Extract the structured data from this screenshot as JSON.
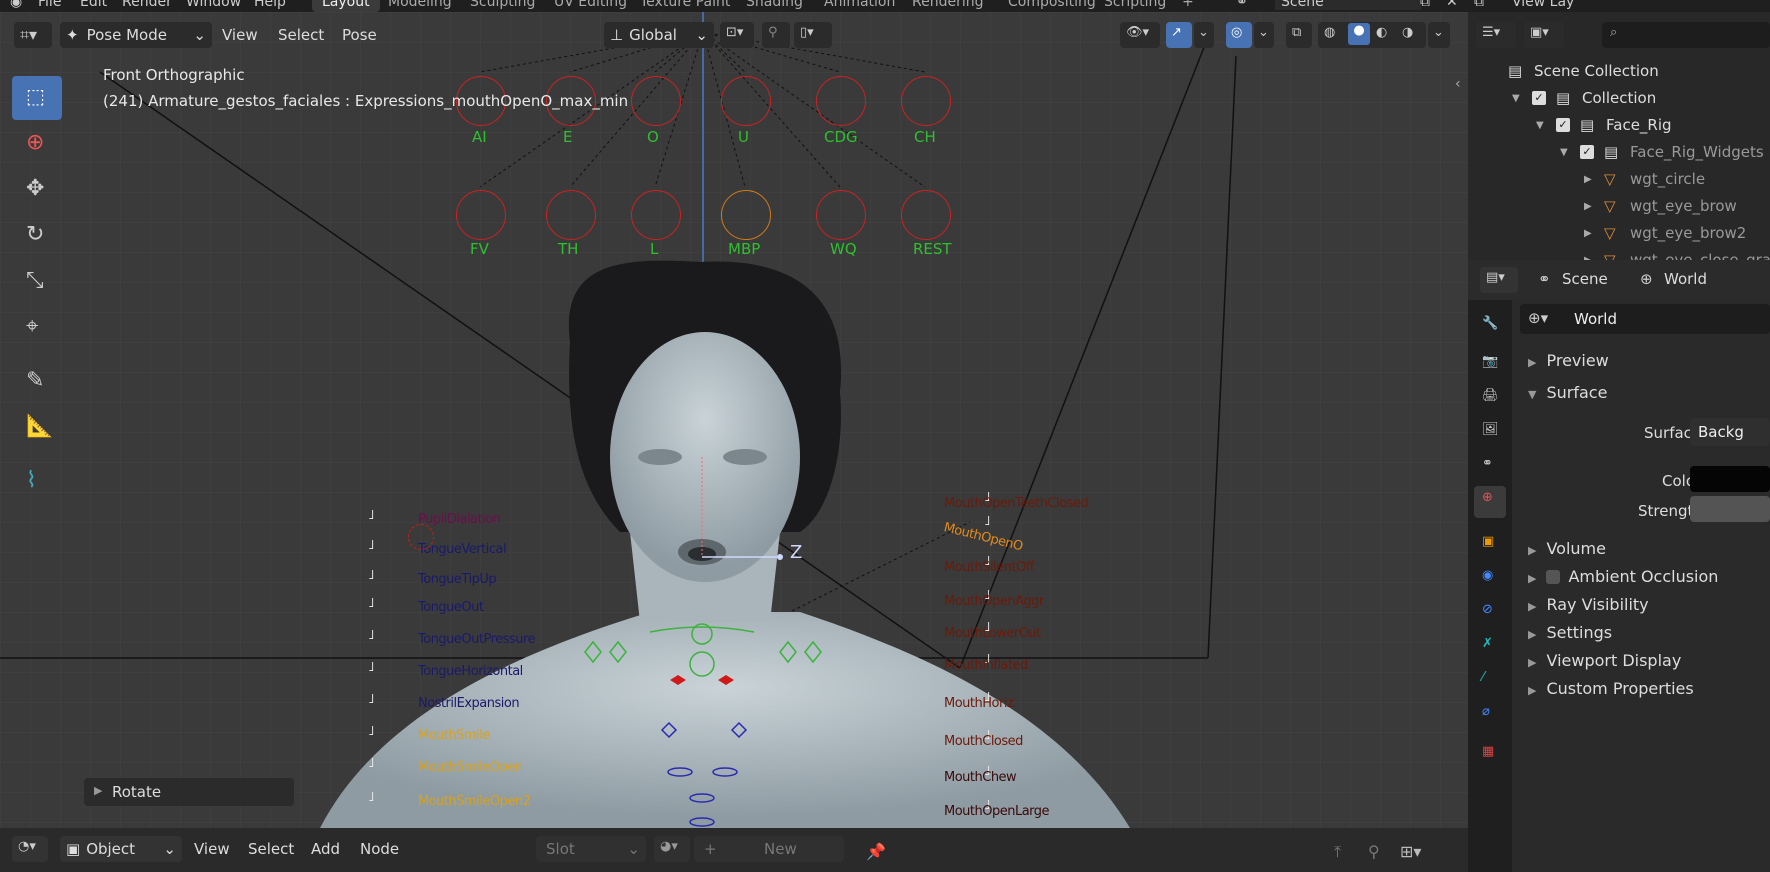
{
  "topbar": {
    "menus": [
      "File",
      "Edit",
      "Render",
      "Window",
      "Help"
    ],
    "workspaces": [
      "Layout",
      "Modeling",
      "Sculpting",
      "UV Editing",
      "Texture Paint",
      "Shading",
      "Animation",
      "Rendering",
      "Compositing",
      "Scripting"
    ],
    "active_workspace": "Layout",
    "add_tab": "+",
    "scene": "Scene",
    "view_layer": "View Lay"
  },
  "viewport_header": {
    "mode": "Pose Mode",
    "menus": [
      "View",
      "Select",
      "Pose"
    ],
    "orientation": "Global"
  },
  "viewport_overlay": {
    "view_name": "Front Orthographic",
    "object_info": "(241) Armature_gestos_faciales : Expressions_mouthOpenO_max_min",
    "gizmo_axis": "Z",
    "last_op": "Rotate"
  },
  "phonemes_row1": [
    "AI",
    "E",
    "O",
    "U",
    "CDG",
    "CH"
  ],
  "phonemes_row2": [
    "FV",
    "TH",
    "L",
    "MBP",
    "WQ",
    "REST"
  ],
  "left_bones": [
    {
      "label": "PupilDialation",
      "color": "#6a0f4a"
    },
    {
      "label": "TongueVertical",
      "color": "#1a1a6a"
    },
    {
      "label": "TongueTipUp",
      "color": "#1a1a6a"
    },
    {
      "label": "TongueOut",
      "color": "#1a1a6a"
    },
    {
      "label": "TongueOutPressure",
      "color": "#1a1a6a"
    },
    {
      "label": "TongueHorizontal",
      "color": "#1a1a6a"
    },
    {
      "label": "NostrilExpansion",
      "color": "#1a1a6a"
    },
    {
      "label": "MouthSmile",
      "color": "#d9a21a"
    },
    {
      "label": "MouthSmileOpen",
      "color": "#d9a21a"
    },
    {
      "label": "MouthSmileOpen2",
      "color": "#d9a21a"
    }
  ],
  "right_bones": [
    {
      "label": "MouthOpenTeethClosed",
      "color": "#6a1a0a"
    },
    {
      "label": "MouthOpenO",
      "color": "#e08a1a"
    },
    {
      "label": "MouthSilentOff",
      "color": "#6a1a0a"
    },
    {
      "label": "MouthOpenAggr",
      "color": "#6a1a0a"
    },
    {
      "label": "MouthLowerOut",
      "color": "#6a1a0a"
    },
    {
      "label": "MouthInflated",
      "color": "#6a1a0a"
    },
    {
      "label": "MouthHoriz",
      "color": "#6a1a0a"
    },
    {
      "label": "MouthClosed",
      "color": "#6a1a0a"
    },
    {
      "label": "MouthChew",
      "color": "#3a0a0a"
    },
    {
      "label": "MouthOpenLarge",
      "color": "#3a0a0a"
    }
  ],
  "bottom_header": {
    "mode": "Object",
    "menus": [
      "View",
      "Select",
      "Add",
      "Node"
    ],
    "slot": "Slot",
    "new_label": "New"
  },
  "outliner": {
    "search_placeholder": "",
    "items": [
      {
        "label": "Scene Collection",
        "indent": 0
      },
      {
        "label": "Collection",
        "indent": 1
      },
      {
        "label": "Face_Rig",
        "indent": 2
      },
      {
        "label": "Face_Rig_Widgets",
        "indent": 3
      },
      {
        "label": "wgt_circle",
        "indent": 4
      },
      {
        "label": "wgt_eye_brow",
        "indent": 4
      },
      {
        "label": "wgt_eye_brow2",
        "indent": 4
      },
      {
        "label": "wgt_eye_close_gra",
        "indent": 4
      }
    ]
  },
  "properties": {
    "context_tabs": [
      "Scene",
      "World"
    ],
    "world_name": "World",
    "panels": [
      {
        "label": "Preview",
        "expanded": false
      },
      {
        "label": "Surface",
        "expanded": true
      }
    ],
    "surface": {
      "surface_label": "Surface",
      "surface_value": "Backg",
      "color_label": "Color",
      "strength_label": "Strength"
    },
    "more_panels": [
      "Volume",
      "Ambient Occlusion",
      "Ray Visibility",
      "Settings",
      "Viewport Display",
      "Custom Properties"
    ]
  },
  "colors": {
    "viewport_bg": "#3a3a3a",
    "accent_blue": "#4772b3",
    "bone_circle": "#c22222",
    "phoneme_green": "#2ec02e"
  }
}
